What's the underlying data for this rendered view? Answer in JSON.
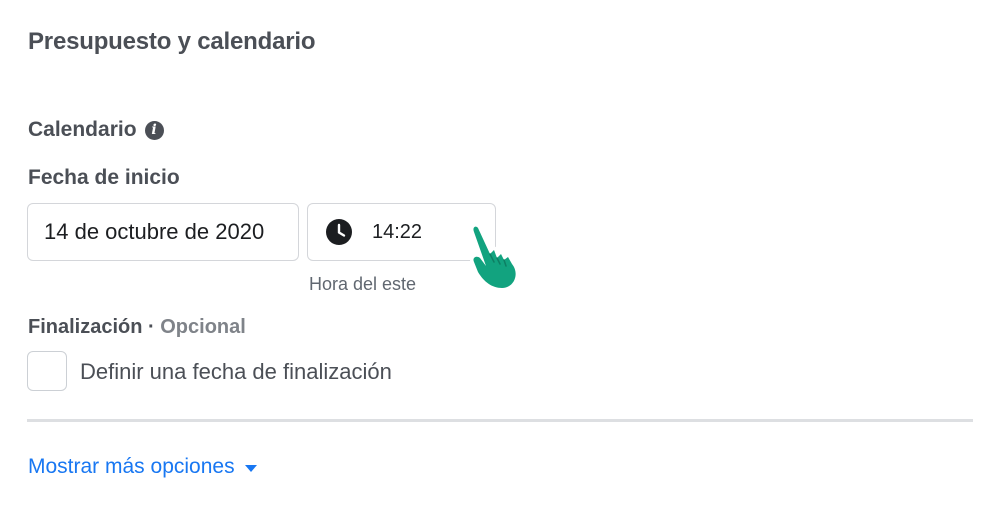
{
  "section": {
    "title": "Presupuesto y calendario"
  },
  "calendar": {
    "label": "Calendario",
    "info_icon": "info-icon"
  },
  "start": {
    "label": "Fecha de inicio",
    "date_value": "14 de octubre de 2020",
    "time_value": "14:22",
    "clock_icon": "clock-icon",
    "timezone": "Hora del este"
  },
  "end": {
    "label": "Finalización",
    "separator": " · ",
    "optional": "Opcional",
    "checkbox_label": "Definir una fecha de finalización",
    "checked": false
  },
  "footer": {
    "more_options": "Mostrar más opciones",
    "caret_icon": "caret-down-icon"
  },
  "colors": {
    "link": "#1877f2",
    "cursor_hand": "#12a37f",
    "text": "#4b4f56"
  }
}
